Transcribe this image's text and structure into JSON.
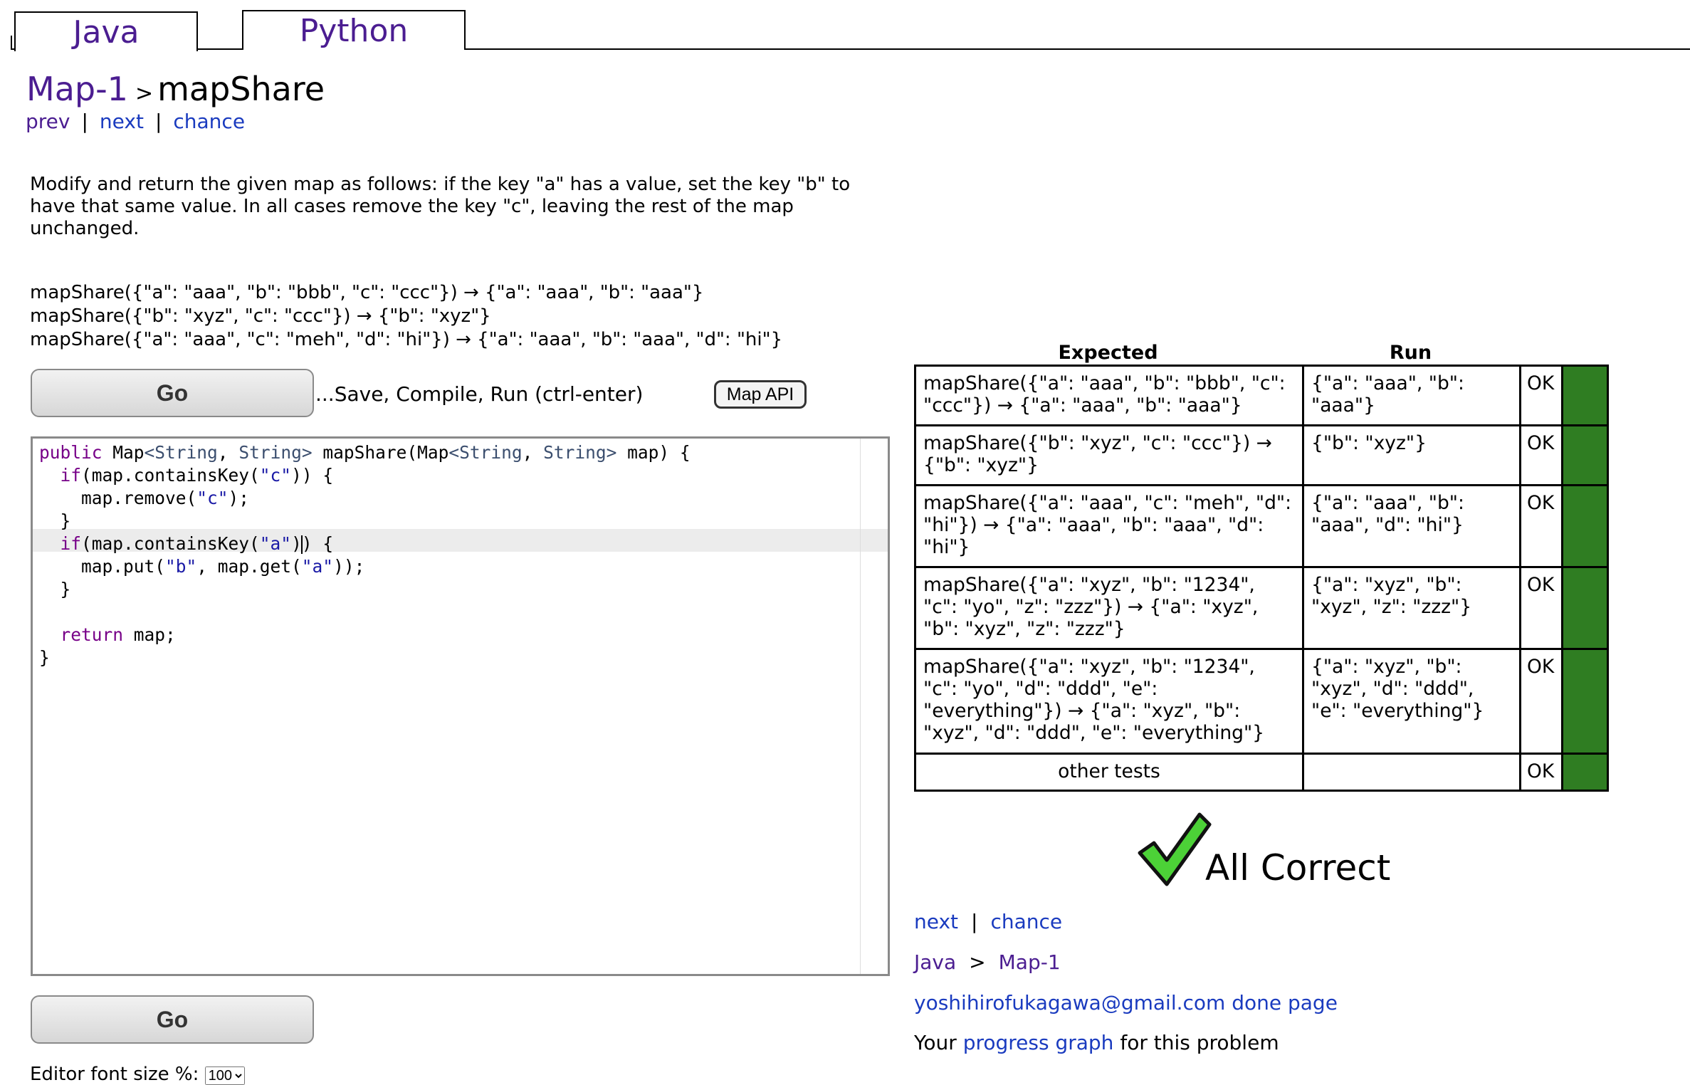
{
  "tabs": [
    {
      "label": "Java"
    },
    {
      "label": "Python"
    }
  ],
  "breadcrumb": {
    "section": "Map-1",
    "separator": ">",
    "problem": "mapShare"
  },
  "nav": {
    "prev": "prev",
    "next": "next",
    "chance": "chance",
    "separator": "|"
  },
  "description": "Modify and return the given map as follows: if the key \"a\" has a value, set the key \"b\" to have that same value. In all cases remove the key \"c\", leaving the rest of the map unchanged.",
  "examples": [
    "mapShare({\"a\": \"aaa\", \"b\": \"bbb\", \"c\": \"ccc\"}) → {\"a\": \"aaa\", \"b\": \"aaa\"}",
    "mapShare({\"b\": \"xyz\", \"c\": \"ccc\"}) → {\"b\": \"xyz\"}",
    "mapShare({\"a\": \"aaa\", \"c\": \"meh\", \"d\": \"hi\"}) → {\"a\": \"aaa\", \"b\": \"aaa\", \"d\": \"hi\"}"
  ],
  "toolbar": {
    "go_label": "Go",
    "save_hint": "...Save, Compile, Run (ctrl-enter)",
    "map_api_label": "Map API"
  },
  "editor": {
    "font_size_label": "Editor font size %:",
    "font_size_value": "100"
  },
  "results": {
    "headers": {
      "expected": "Expected",
      "run": "Run"
    },
    "rows": [
      {
        "expected": "mapShare({\"a\": \"aaa\", \"b\": \"bbb\", \"c\": \"ccc\"}) → {\"a\": \"aaa\", \"b\": \"aaa\"}",
        "run": "{\"a\": \"aaa\", \"b\": \"aaa\"}",
        "status": "OK"
      },
      {
        "expected": "mapShare({\"b\": \"xyz\", \"c\": \"ccc\"}) → {\"b\": \"xyz\"}",
        "run": "{\"b\": \"xyz\"}",
        "status": "OK"
      },
      {
        "expected": "mapShare({\"a\": \"aaa\", \"c\": \"meh\", \"d\": \"hi\"}) → {\"a\": \"aaa\", \"b\": \"aaa\", \"d\": \"hi\"}",
        "run": "{\"a\": \"aaa\", \"b\": \"aaa\", \"d\": \"hi\"}",
        "status": "OK"
      },
      {
        "expected": "mapShare({\"a\": \"xyz\", \"b\": \"1234\", \"c\": \"yo\", \"z\": \"zzz\"}) → {\"a\": \"xyz\", \"b\": \"xyz\", \"z\": \"zzz\"}",
        "run": "{\"a\": \"xyz\", \"b\": \"xyz\", \"z\": \"zzz\"}",
        "status": "OK"
      },
      {
        "expected": "mapShare({\"a\": \"xyz\", \"b\": \"1234\", \"c\": \"yo\", \"d\": \"ddd\", \"e\": \"everything\"}) → {\"a\": \"xyz\", \"b\": \"xyz\", \"d\": \"ddd\", \"e\": \"everything\"}",
        "run": "{\"a\": \"xyz\", \"b\": \"xyz\", \"d\": \"ddd\", \"e\": \"everything\"}",
        "status": "OK"
      }
    ],
    "other_tests": {
      "label": "other tests",
      "status": "OK"
    },
    "pass_color": "#2f7d22"
  },
  "summary": {
    "all_correct": "All Correct",
    "check_color": "#4cd137"
  },
  "footer": {
    "next": "next",
    "separator": "|",
    "chance": "chance",
    "crumb_root": "Java",
    "crumb_sep": ">",
    "crumb_section": "Map-1",
    "email_link": "yoshihirofukagawa@gmail.com done page",
    "progress_prefix": "Your",
    "progress_link": "progress graph",
    "progress_suffix": "for this problem"
  }
}
